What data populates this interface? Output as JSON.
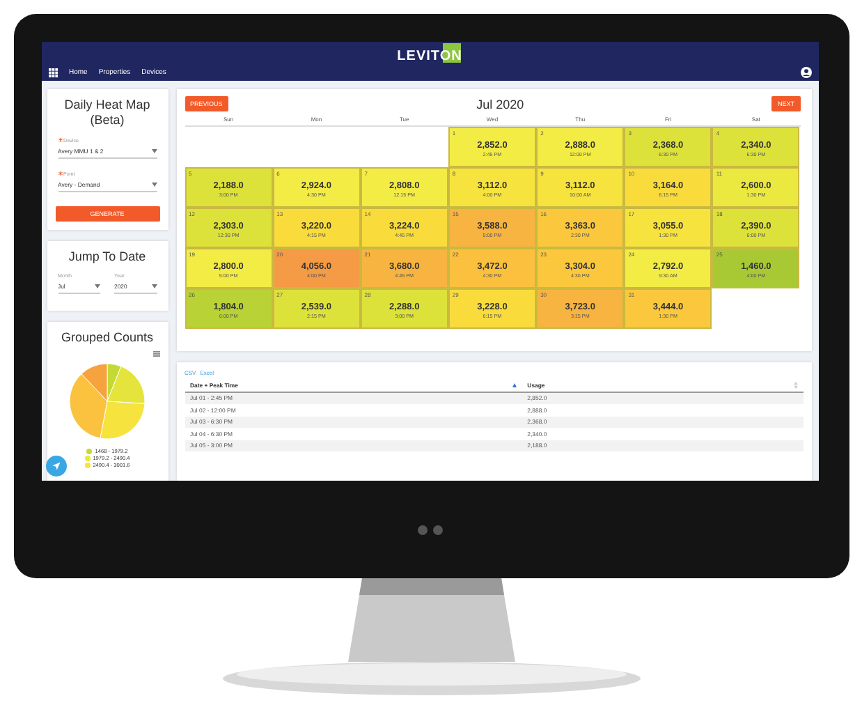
{
  "header": {
    "logo": "LEVITON",
    "nav": [
      {
        "label": "Home"
      },
      {
        "label": "Properties"
      },
      {
        "label": "Devices"
      }
    ]
  },
  "heatmap_form": {
    "title": "Daily Heat Map (Beta)",
    "fields": [
      {
        "label": "Device",
        "required": true,
        "value": "Avery MMU 1 & 2"
      },
      {
        "label": "Point",
        "required": true,
        "value": "Avery - Demand"
      }
    ],
    "button": "GENERATE"
  },
  "jump": {
    "title": "Jump To Date",
    "fields": [
      {
        "label": "Month",
        "value": "Jul"
      },
      {
        "label": "Year",
        "value": "2020"
      }
    ]
  },
  "grouped": {
    "title": "Grouped Counts",
    "legend": [
      {
        "label": "1468 - 1979.2",
        "color": "#c5d936"
      },
      {
        "label": "1979.2 - 2490.4",
        "color": "#ece83c"
      },
      {
        "label": "2490.4 - 3001.6",
        "color": "#f7e33e"
      }
    ]
  },
  "calendar": {
    "previous": "PREVIOUS",
    "title": "Jul 2020",
    "next": "NEXT",
    "weekdays": [
      "Sun",
      "Mon",
      "Tue",
      "Wed",
      "Thu",
      "Fri",
      "Sat"
    ],
    "weeks": [
      [
        {
          "kind": "blank"
        },
        {
          "kind": "blank"
        },
        {
          "kind": "blank"
        },
        {
          "kind": "day",
          "day": "1",
          "value": "2,852.0",
          "time": "2:45 PM",
          "color": "#f3ec45"
        },
        {
          "kind": "day",
          "day": "2",
          "value": "2,888.0",
          "time": "12:00 PM",
          "color": "#f3ec45"
        },
        {
          "kind": "day",
          "day": "3",
          "value": "2,368.0",
          "time": "6:30 PM",
          "color": "#dde23a"
        },
        {
          "kind": "day",
          "day": "4",
          "value": "2,340.0",
          "time": "6:30 PM",
          "color": "#dde23a"
        }
      ],
      [
        {
          "kind": "day",
          "day": "5",
          "value": "2,188.0",
          "time": "3:00 PM",
          "color": "#dde23a"
        },
        {
          "kind": "day",
          "day": "6",
          "value": "2,924.0",
          "time": "4:30 PM",
          "color": "#f3ec45"
        },
        {
          "kind": "day",
          "day": "7",
          "value": "2,808.0",
          "time": "12:15 PM",
          "color": "#f3ec45"
        },
        {
          "kind": "day",
          "day": "8",
          "value": "3,112.0",
          "time": "4:00 PM",
          "color": "#f7e33e"
        },
        {
          "kind": "day",
          "day": "9",
          "value": "3,112.0",
          "time": "10:00 AM",
          "color": "#f7e33e"
        },
        {
          "kind": "day",
          "day": "10",
          "value": "3,164.0",
          "time": "6:15 PM",
          "color": "#f9dc3c"
        },
        {
          "kind": "day",
          "day": "11",
          "value": "2,600.0",
          "time": "1:30 PM",
          "color": "#ebe83f"
        }
      ],
      [
        {
          "kind": "day",
          "day": "12",
          "value": "2,303.0",
          "time": "12:30 PM",
          "color": "#dde23a"
        },
        {
          "kind": "day",
          "day": "13",
          "value": "3,220.0",
          "time": "4:15 PM",
          "color": "#f9dc3c"
        },
        {
          "kind": "day",
          "day": "14",
          "value": "3,224.0",
          "time": "4:45 PM",
          "color": "#f9dc3c"
        },
        {
          "kind": "day",
          "day": "15",
          "value": "3,588.0",
          "time": "5:00 PM",
          "color": "#f8b440"
        },
        {
          "kind": "day",
          "day": "16",
          "value": "3,363.0",
          "time": "2:30 PM",
          "color": "#fbc83d"
        },
        {
          "kind": "day",
          "day": "17",
          "value": "3,055.0",
          "time": "1:30 PM",
          "color": "#f7e33e"
        },
        {
          "kind": "day",
          "day": "18",
          "value": "2,390.0",
          "time": "6:00 PM",
          "color": "#dde23a"
        }
      ],
      [
        {
          "kind": "day",
          "day": "19",
          "value": "2,800.0",
          "time": "5:00 PM",
          "color": "#f3ec45"
        },
        {
          "kind": "day",
          "day": "20",
          "value": "4,056.0",
          "time": "4:00 PM",
          "color": "#f59a45"
        },
        {
          "kind": "day",
          "day": "21",
          "value": "3,680.0",
          "time": "4:45 PM",
          "color": "#f8b440"
        },
        {
          "kind": "day",
          "day": "22",
          "value": "3,472.0",
          "time": "4:30 PM",
          "color": "#fbc03d"
        },
        {
          "kind": "day",
          "day": "23",
          "value": "3,304.0",
          "time": "4:30 PM",
          "color": "#fbc83d"
        },
        {
          "kind": "day",
          "day": "24",
          "value": "2,792.0",
          "time": "9:30 AM",
          "color": "#f3ec45"
        },
        {
          "kind": "day",
          "day": "25",
          "value": "1,460.0",
          "time": "4:00 PM",
          "color": "#a9c934"
        }
      ],
      [
        {
          "kind": "day",
          "day": "26",
          "value": "1,804.0",
          "time": "6:00 PM",
          "color": "#b9d235"
        },
        {
          "kind": "day",
          "day": "27",
          "value": "2,539.0",
          "time": "2:15 PM",
          "color": "#dde23a"
        },
        {
          "kind": "day",
          "day": "28",
          "value": "2,288.0",
          "time": "3:00 PM",
          "color": "#dde23a"
        },
        {
          "kind": "day",
          "day": "29",
          "value": "3,228.0",
          "time": "6:15 PM",
          "color": "#f9dc3c"
        },
        {
          "kind": "day",
          "day": "30",
          "value": "3,723.0",
          "time": "3:15 PM",
          "color": "#f8b440"
        },
        {
          "kind": "day",
          "day": "31",
          "value": "3,444.0",
          "time": "1:30 PM",
          "color": "#fbc83d"
        },
        {
          "kind": "blank"
        }
      ]
    ]
  },
  "table": {
    "exports": [
      "CSV",
      "Excel"
    ],
    "columns": [
      {
        "label": "Date + Peak Time",
        "sorted": true
      },
      {
        "label": "Usage",
        "sorted": false
      }
    ],
    "rows": [
      [
        "Jul 01 - 2:45 PM",
        "2,852.0"
      ],
      [
        "Jul 02 - 12:00 PM",
        "2,888.0"
      ],
      [
        "Jul 03 - 6:30 PM",
        "2,368.0"
      ],
      [
        "Jul 04 - 6:30 PM",
        "2,340.0"
      ],
      [
        "Jul 05 - 3:00 PM",
        "2,188.0"
      ]
    ]
  }
}
